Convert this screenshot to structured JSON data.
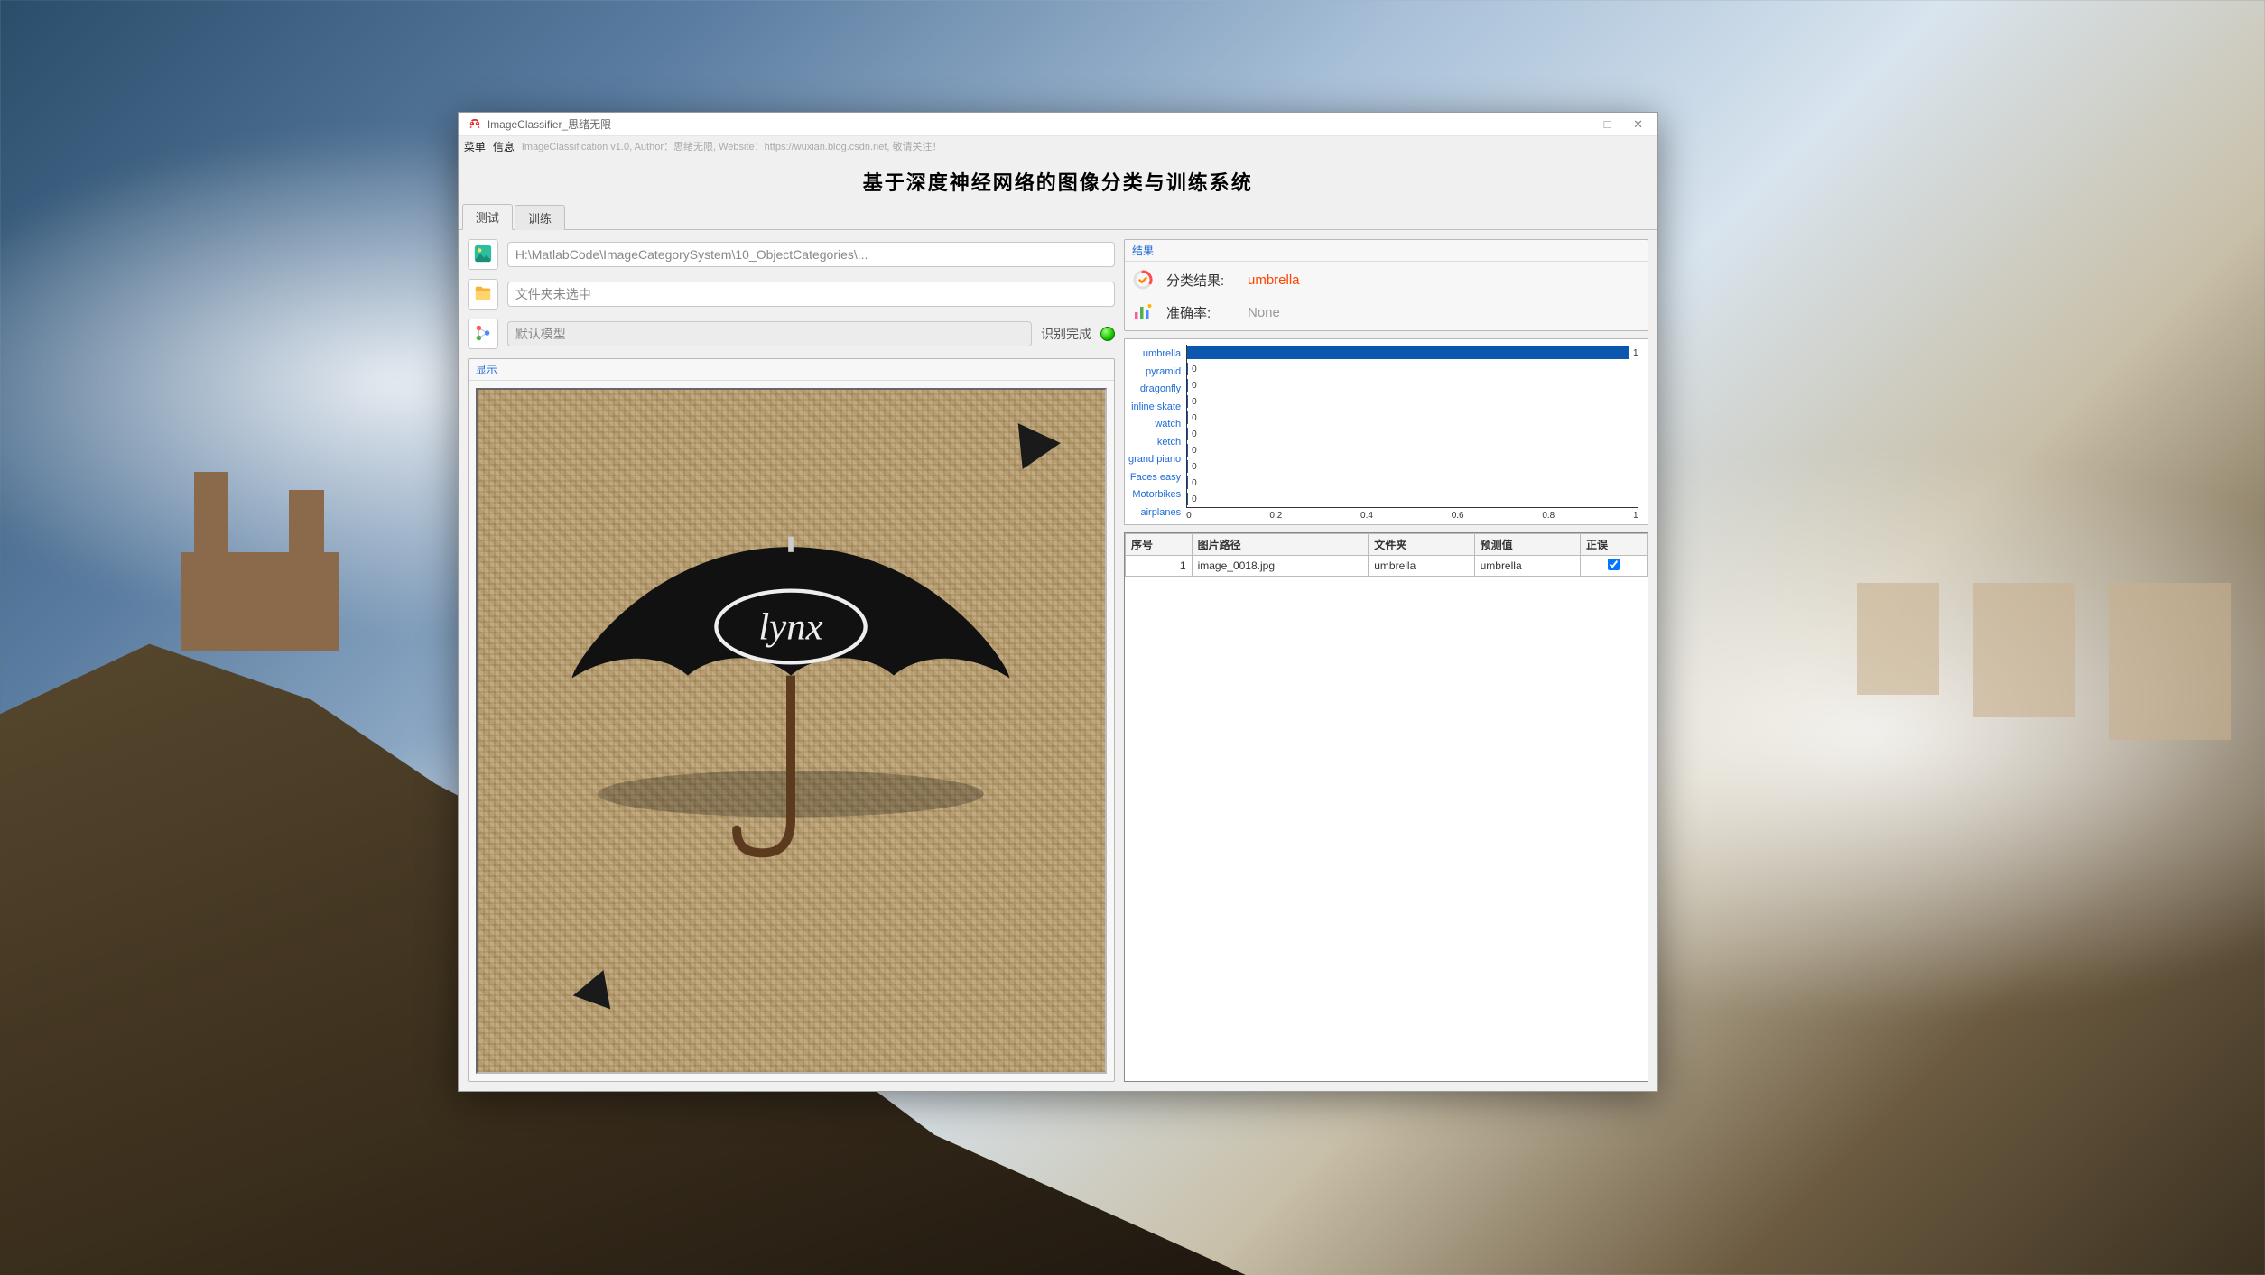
{
  "window": {
    "title": "ImageClassifier_思绪无限",
    "menu": {
      "item1": "菜单",
      "item2": "信息"
    },
    "info_bar": "ImageClassification v1.0, Author：思绪无限, Website：https://wuxian.blog.csdn.net, 敬请关注！"
  },
  "heading": "基于深度神经网络的图像分类与训练系统",
  "tabs": {
    "test": "测试",
    "train": "训练"
  },
  "left": {
    "image_path": "H:\\MatlabCode\\ImageCategorySystem\\10_ObjectCategories\\...",
    "folder_text": "文件夹未选中",
    "model_text": "默认模型",
    "status_text": "识别完成",
    "display_title": "显示"
  },
  "right": {
    "panel_title": "结果",
    "class_label": "分类结果:",
    "class_value": "umbrella",
    "acc_label": "准确率:",
    "acc_value": "None"
  },
  "chart_data": {
    "type": "bar",
    "orientation": "horizontal",
    "categories": [
      "umbrella",
      "pyramid",
      "dragonfly",
      "inline skate",
      "watch",
      "ketch",
      "grand piano",
      "Faces easy",
      "Motorbikes",
      "airplanes"
    ],
    "values": [
      1,
      0,
      0,
      0,
      0,
      0,
      0,
      0,
      0,
      0
    ],
    "xlim": [
      0,
      1
    ],
    "xticks": [
      0,
      0.2,
      0.4,
      0.6,
      0.8,
      1
    ],
    "title": "",
    "xlabel": "",
    "ylabel": ""
  },
  "table": {
    "headers": {
      "idx": "序号",
      "path": "图片路径",
      "folder": "文件夹",
      "pred": "预测值",
      "correct": "正误"
    },
    "rows": [
      {
        "idx": 1,
        "path": "image_0018.jpg",
        "folder": "umbrella",
        "pred": "umbrella",
        "correct": true
      }
    ]
  }
}
